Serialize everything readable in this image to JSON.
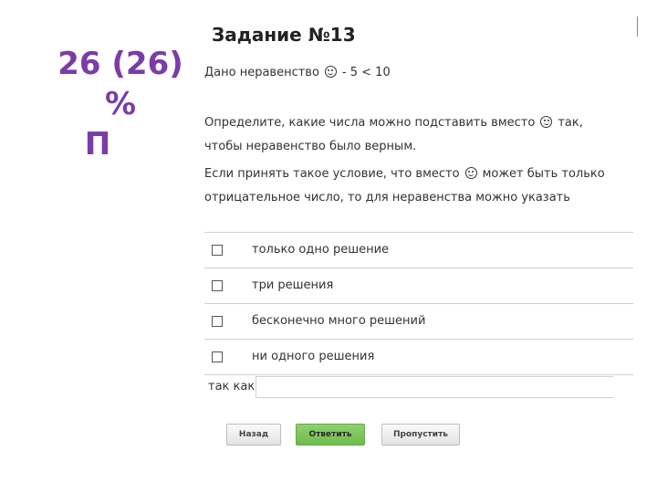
{
  "slide": {
    "caption_line1": "26 (26) %",
    "caption_line2": "П",
    "caption_color": "#7b3ca8"
  },
  "task": {
    "title": "Задание №13",
    "given_prefix": "Дано неравенство",
    "given_suffix": "- 5 < 10",
    "paragraph1_a": "Определите, какие числа можно подставить вместо",
    "paragraph1_b": "так,",
    "paragraph1_c": "чтобы неравенство было верным.",
    "paragraph2_a": "Если принять такое условие, что вместо",
    "paragraph2_b": "может быть только",
    "paragraph2_c": "отрицательное число, то для неравенства можно указать",
    "options": [
      "только одно решение",
      "три решения",
      "бесконечно много решений",
      "ни одного решения"
    ],
    "since_label": "так как",
    "since_value": ""
  },
  "buttons": {
    "back": "Назад",
    "answer": "Ответить",
    "skip": "Пропустить"
  },
  "colors": {
    "answer_button": "#7cc45a",
    "accent_edge": "#4caf50"
  }
}
